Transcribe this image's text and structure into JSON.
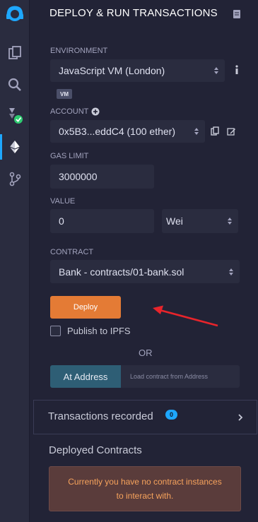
{
  "icon_bar": {
    "icons": [
      "remix-logo-icon",
      "file-explorer-icon",
      "search-icon",
      "solidity-compiler-icon",
      "deploy-run-icon",
      "git-icon"
    ]
  },
  "header": {
    "title": "DEPLOY & RUN TRANSACTIONS"
  },
  "environment": {
    "label": "ENVIRONMENT",
    "value": "JavaScript VM (London)",
    "badge": "VM"
  },
  "account": {
    "label": "ACCOUNT",
    "value": "0x5B3...eddC4 (100 ether)"
  },
  "gas_limit": {
    "label": "GAS LIMIT",
    "value": "3000000"
  },
  "value": {
    "label": "VALUE",
    "amount": "0",
    "unit": "Wei"
  },
  "contract": {
    "label": "CONTRACT",
    "value": "Bank - contracts/01-bank.sol"
  },
  "deploy": {
    "label": "Deploy"
  },
  "publish": {
    "label": "Publish to IPFS",
    "checked": false
  },
  "or_text": "OR",
  "at_address": {
    "button_label": "At Address",
    "placeholder": "Load contract from Address"
  },
  "transactions": {
    "label": "Transactions recorded",
    "count": "0"
  },
  "deployed": {
    "title": "Deployed Contracts",
    "empty_message": "Currently you have no contract instances to interact with."
  },
  "colors": {
    "accent": "#1ea7fd",
    "deploy_button": "#e47b35",
    "at_address_button": "#2e5e75",
    "notice_bg": "#5a3c3b",
    "notice_text": "#f7a35c",
    "annotation_arrow": "#e8242b",
    "success_check": "#2ecc71"
  }
}
